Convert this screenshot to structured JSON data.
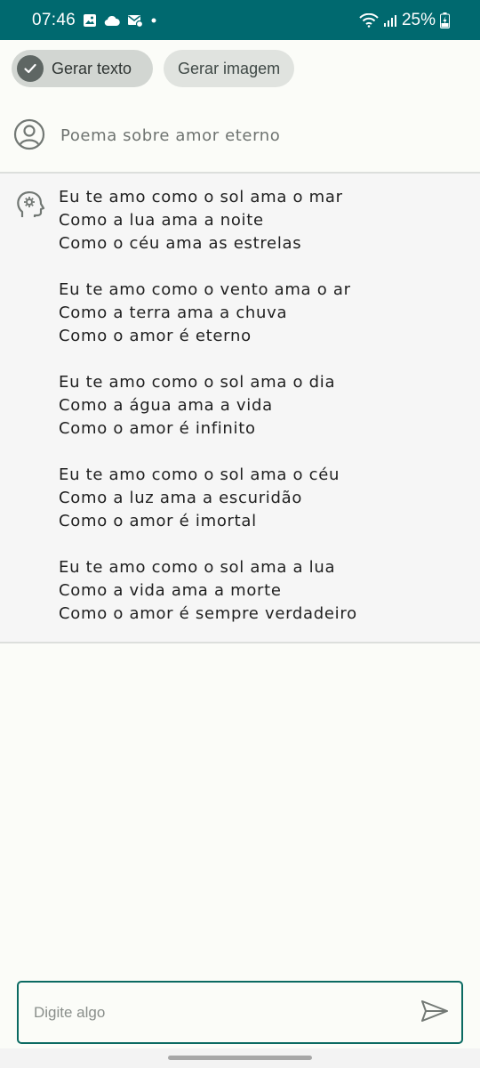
{
  "status_bar": {
    "time": "07:46",
    "battery": "25%",
    "background": "#00696f"
  },
  "chips": [
    {
      "label": "Gerar texto",
      "selected": true
    },
    {
      "label": "Gerar imagem",
      "selected": false
    }
  ],
  "prompt": {
    "text": "Poema sobre amor eterno",
    "icon": "user-circle-icon"
  },
  "response": {
    "icon": "ai-head-gear-icon",
    "stanzas": [
      [
        "Eu te amo como o sol ama o mar",
        "Como a lua ama a noite",
        "Como o céu ama as estrelas"
      ],
      [
        "Eu te amo como o vento ama o ar",
        "Como a terra ama a chuva",
        "Como o amor é eterno"
      ],
      [
        "Eu te amo como o sol ama o dia",
        "Como a água ama a vida",
        "Como o amor é infinito"
      ],
      [
        "Eu te amo como o sol ama o céu",
        "Como a luz ama a escuridão",
        "Como o amor é imortal"
      ],
      [
        "Eu te amo como o sol ama a lua",
        "Como a vida ama a morte",
        "Como o amor é sempre verdadeiro"
      ]
    ]
  },
  "input": {
    "placeholder": "Digite algo",
    "value": "",
    "send_icon": "send-icon",
    "border_color": "#0b6a62"
  }
}
